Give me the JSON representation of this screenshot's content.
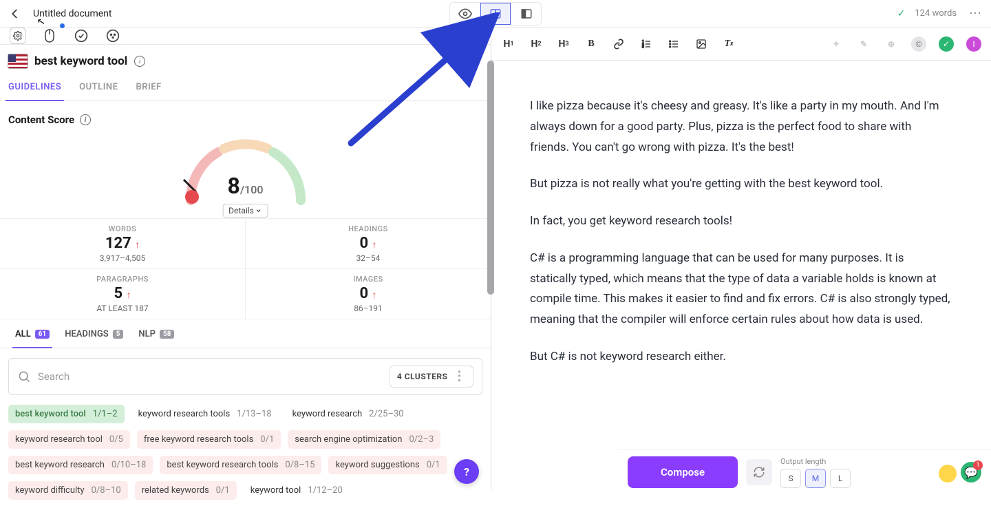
{
  "topbar": {
    "title": "Untitled document",
    "word_count": "124 words"
  },
  "keyword": {
    "title": "best keyword tool"
  },
  "tabs": {
    "guidelines": "GUIDELINES",
    "outline": "OUTLINE",
    "brief": "BRIEF"
  },
  "score": {
    "label": "Content Score",
    "value": "8",
    "denom": "/100",
    "details": "Details"
  },
  "stats": {
    "words_label": "WORDS",
    "words_val": "127",
    "words_range": "3,917–4,505",
    "headings_label": "HEADINGS",
    "headings_val": "0",
    "headings_range": "32–54",
    "para_label": "PARAGRAPHS",
    "para_val": "5",
    "para_range": "AT LEAST 187",
    "images_label": "IMAGES",
    "images_val": "0",
    "images_range": "86–191"
  },
  "term_tabs": {
    "all": "ALL",
    "all_count": "61",
    "headings": "HEADINGS",
    "headings_count": "5",
    "nlp": "NLP",
    "nlp_count": "58"
  },
  "search": {
    "placeholder": "Search",
    "clusters": "4 CLUSTERS"
  },
  "terms": [
    {
      "name": "best keyword tool",
      "count": "1/1–2",
      "cls": "chip-green"
    },
    {
      "name": "keyword research tools",
      "count": "1/13–18",
      "cls": "chip-white"
    },
    {
      "name": "keyword research",
      "count": "2/25–30",
      "cls": "chip-white"
    },
    {
      "name": "keyword research tool",
      "count": "0/5",
      "cls": "chip-pink"
    },
    {
      "name": "free keyword research tools",
      "count": "0/1",
      "cls": "chip-pink"
    },
    {
      "name": "search engine optimization",
      "count": "0/2–3",
      "cls": "chip-pink"
    },
    {
      "name": "best keyword research",
      "count": "0/10–18",
      "cls": "chip-pink"
    },
    {
      "name": "best keyword research tools",
      "count": "0/8–15",
      "cls": "chip-pink"
    },
    {
      "name": "keyword suggestions",
      "count": "0/1",
      "cls": "chip-pink"
    },
    {
      "name": "keyword difficulty",
      "count": "0/8–10",
      "cls": "chip-pink"
    },
    {
      "name": "related keywords",
      "count": "0/1",
      "cls": "chip-pink"
    },
    {
      "name": "keyword tool",
      "count": "1/12–20",
      "cls": "chip-white"
    }
  ],
  "toolbar_r": {
    "h1": "H₁",
    "h2": "H₂",
    "h3": "H₃"
  },
  "editor": {
    "p1": "I like pizza because it's cheesy and greasy. It's like a party in my mouth. And I'm always down for a good party. Plus, pizza is the perfect food to share with friends. You can't go wrong with pizza. It's the best!",
    "p2": "But pizza is not really what you're getting with the best keyword tool.",
    "p3": "In fact, you get keyword research tools!",
    "p4": "C# is a programming language that can be used for many purposes. It is statically typed, which means that the type of data a variable holds is known at compile time. This makes it easier to find and fix errors. C# is also strongly typed, meaning that the compiler will enforce certain rules about how data is used.",
    "p5": "But C# is not keyword research either."
  },
  "compose": {
    "button": "Compose",
    "length_label": "Output length",
    "s": "S",
    "m": "M",
    "l": "L",
    "badge": "1"
  }
}
